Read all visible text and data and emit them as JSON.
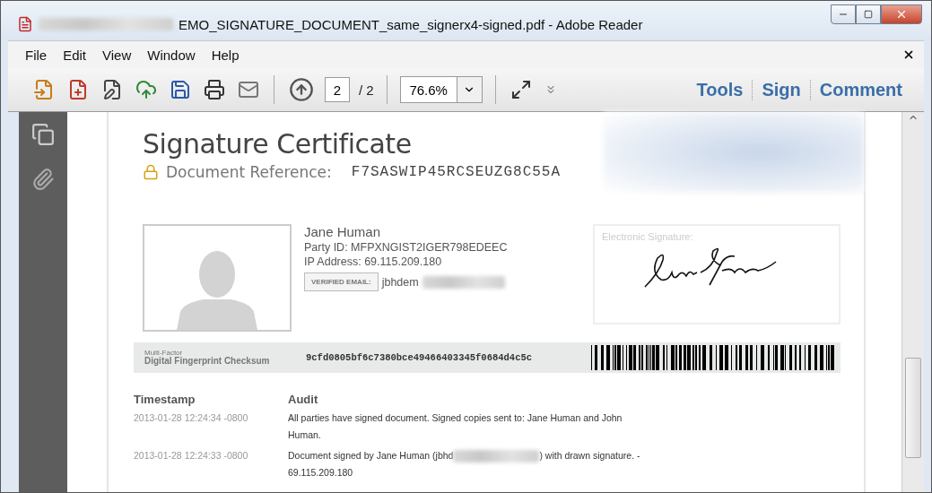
{
  "window": {
    "title": "EMO_SIGNATURE_DOCUMENT_same_signerx4-signed.pdf - Adobe Reader"
  },
  "menu": [
    {
      "label": "File"
    },
    {
      "label": "Edit"
    },
    {
      "label": "View"
    },
    {
      "label": "Window"
    },
    {
      "label": "Help"
    }
  ],
  "toolbar": {
    "page_number": "2",
    "page_total": "/ 2",
    "zoom": "76.6%",
    "panels": [
      {
        "label": "Tools"
      },
      {
        "label": "Sign"
      },
      {
        "label": "Comment"
      }
    ]
  },
  "document": {
    "title": "Signature Certificate",
    "reference_label": "Document Reference:",
    "reference": "F7SASWIP45RCSEUZG8C55A",
    "signer": {
      "name": "Jane Human",
      "party_id": "Party ID: MFPXNGIST2IGER798EDEEC",
      "ip": "IP Address: 69.115.209.180",
      "email_badge": "VERIFIED EMAIL:",
      "email_visible": "jbhdem"
    },
    "signature_label": "Electronic Signature:",
    "checksum": {
      "label_small": "Multi-Factor",
      "label": "Digital Fingerprint Checksum",
      "value": "9cfd0805bf6c7380bce49466403345f0684d4c5c"
    },
    "audit": {
      "columns": [
        "Timestamp",
        "Audit"
      ],
      "rows": [
        {
          "timestamp": "2013-01-28 12:24:34 -0800",
          "text_before": "All parties have signed document. Signed copies sent to: Jane Human and John Human.",
          "redacted": false
        },
        {
          "timestamp": "2013-01-28 12:24:33 -0800",
          "text_before": "Document signed by Jane Human (jbhd",
          "redacted": true,
          "text_after": ") with drawn signature. - 69.115.209.180"
        }
      ]
    }
  }
}
